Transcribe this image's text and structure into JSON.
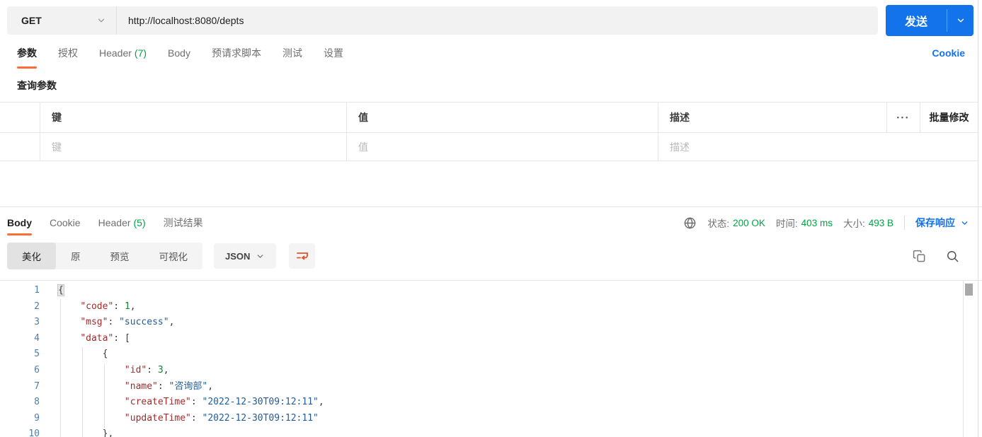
{
  "colors": {
    "accent_orange": "#FF6C37",
    "primary_blue": "#1273EB",
    "success_green": "#00A344",
    "code_key": "#A22C2C",
    "code_string": "#1F5C99",
    "code_number": "#188038",
    "code_line_number": "#4D7EA8"
  },
  "request": {
    "method": "GET",
    "url": "http://localhost:8080/depts",
    "send_label": "发送",
    "tabs": [
      {
        "label": "参数",
        "active": true
      },
      {
        "label": "授权"
      },
      {
        "label": "Header",
        "count": "(7)"
      },
      {
        "label": "Body"
      },
      {
        "label": "预请求脚本"
      },
      {
        "label": "测试"
      },
      {
        "label": "设置"
      }
    ],
    "cookie_link": "Cookie",
    "query_params_title": "查询参数",
    "table": {
      "headers": {
        "key": "键",
        "value": "值",
        "desc": "描述",
        "more": "•••",
        "bulk_edit": "批量修改"
      },
      "placeholders": {
        "key": "键",
        "value": "值",
        "desc": "描述"
      }
    }
  },
  "response": {
    "tabs": [
      {
        "label": "Body",
        "active": true
      },
      {
        "label": "Cookie"
      },
      {
        "label": "Header",
        "count": "(5)"
      },
      {
        "label": "测试结果"
      }
    ],
    "status_items": [
      {
        "label": "状态:",
        "value": "200 OK"
      },
      {
        "label": "时间:",
        "value": "403 ms"
      },
      {
        "label": "大小:",
        "value": "493 B"
      }
    ],
    "save_response_label": "保存响应",
    "view_modes": [
      {
        "label": "美化",
        "active": true
      },
      {
        "label": "原"
      },
      {
        "label": "预览"
      },
      {
        "label": "可视化"
      }
    ],
    "format_label": "JSON",
    "body_lines": [
      {
        "n": "1",
        "tokens": [
          [
            "brh",
            "{"
          ]
        ]
      },
      {
        "n": "2",
        "tokens": [
          [
            "pun",
            "    "
          ],
          [
            "key",
            "\"code\""
          ],
          [
            "pun",
            ": "
          ],
          [
            "num",
            "1"
          ],
          [
            "pun",
            ","
          ]
        ]
      },
      {
        "n": "3",
        "tokens": [
          [
            "pun",
            "    "
          ],
          [
            "key",
            "\"msg\""
          ],
          [
            "pun",
            ": "
          ],
          [
            "str",
            "\"success\""
          ],
          [
            "pun",
            ","
          ]
        ]
      },
      {
        "n": "4",
        "tokens": [
          [
            "pun",
            "    "
          ],
          [
            "key",
            "\"data\""
          ],
          [
            "pun",
            ": "
          ],
          [
            "pun",
            "["
          ]
        ]
      },
      {
        "n": "5",
        "tokens": [
          [
            "pun",
            "        "
          ],
          [
            "pun",
            "{"
          ]
        ]
      },
      {
        "n": "6",
        "tokens": [
          [
            "pun",
            "            "
          ],
          [
            "key",
            "\"id\""
          ],
          [
            "pun",
            ": "
          ],
          [
            "num",
            "3"
          ],
          [
            "pun",
            ","
          ]
        ]
      },
      {
        "n": "7",
        "tokens": [
          [
            "pun",
            "            "
          ],
          [
            "key",
            "\"name\""
          ],
          [
            "pun",
            ": "
          ],
          [
            "str",
            "\"咨询部\""
          ],
          [
            "pun",
            ","
          ]
        ]
      },
      {
        "n": "8",
        "tokens": [
          [
            "pun",
            "            "
          ],
          [
            "key",
            "\"createTime\""
          ],
          [
            "pun",
            ": "
          ],
          [
            "str",
            "\"2022-12-30T09:12:11\""
          ],
          [
            "pun",
            ","
          ]
        ]
      },
      {
        "n": "9",
        "tokens": [
          [
            "pun",
            "            "
          ],
          [
            "key",
            "\"updateTime\""
          ],
          [
            "pun",
            ": "
          ],
          [
            "str",
            "\"2022-12-30T09:12:11\""
          ]
        ]
      },
      {
        "n": "10",
        "tokens": [
          [
            "pun",
            "        "
          ],
          [
            "pun",
            "},"
          ]
        ]
      }
    ]
  }
}
